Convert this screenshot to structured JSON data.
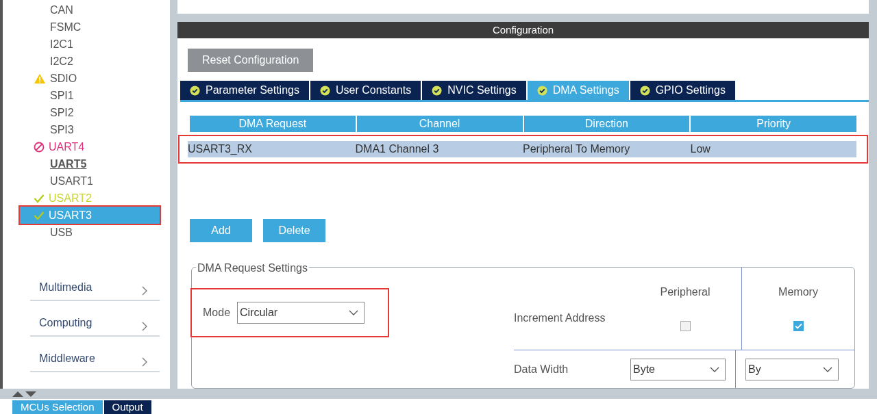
{
  "sidebar": {
    "items": [
      {
        "label": "CAN",
        "kind": "plain",
        "emphasized": false,
        "selected": false,
        "highlighted": false
      },
      {
        "label": "FSMC",
        "kind": "plain",
        "emphasized": false,
        "selected": false,
        "highlighted": false
      },
      {
        "label": "I2C1",
        "kind": "plain",
        "emphasized": false,
        "selected": false,
        "highlighted": false
      },
      {
        "label": "I2C2",
        "kind": "plain",
        "emphasized": false,
        "selected": false,
        "highlighted": false
      },
      {
        "label": "SDIO",
        "kind": "warning",
        "emphasized": false,
        "selected": false,
        "highlighted": false
      },
      {
        "label": "SPI1",
        "kind": "plain",
        "emphasized": false,
        "selected": false,
        "highlighted": false
      },
      {
        "label": "SPI2",
        "kind": "plain",
        "emphasized": false,
        "selected": false,
        "highlighted": false
      },
      {
        "label": "SPI3",
        "kind": "plain",
        "emphasized": false,
        "selected": false,
        "highlighted": false
      },
      {
        "label": "UART4",
        "kind": "error",
        "emphasized": false,
        "selected": false,
        "highlighted": false
      },
      {
        "label": "UART5",
        "kind": "plain",
        "emphasized": true,
        "selected": false,
        "highlighted": false
      },
      {
        "label": "USART1",
        "kind": "plain",
        "emphasized": false,
        "selected": false,
        "highlighted": false
      },
      {
        "label": "USART2",
        "kind": "ok",
        "emphasized": false,
        "selected": false,
        "highlighted": false
      },
      {
        "label": "USART3",
        "kind": "ok",
        "emphasized": false,
        "selected": true,
        "highlighted": true
      },
      {
        "label": "USB",
        "kind": "plain",
        "emphasized": false,
        "selected": false,
        "highlighted": false
      }
    ],
    "categories": [
      "Multimedia",
      "Computing",
      "Middleware"
    ]
  },
  "configuration": {
    "title": "Configuration",
    "reset_button": "Reset Configuration",
    "tabs": [
      {
        "label": "Parameter Settings",
        "selected": false
      },
      {
        "label": "User Constants",
        "selected": false
      },
      {
        "label": "NVIC Settings",
        "selected": false
      },
      {
        "label": "DMA Settings",
        "selected": true
      },
      {
        "label": "GPIO Settings",
        "selected": false
      }
    ],
    "table": {
      "columns": [
        "DMA Request",
        "Channel",
        "Direction",
        "Priority"
      ],
      "rows": [
        {
          "cells": [
            "USART3_RX",
            "DMA1 Channel 3",
            "Peripheral To Memory",
            "Low"
          ],
          "highlighted": true
        }
      ]
    },
    "buttons": [
      "Add",
      "Delete"
    ],
    "settings": {
      "title": "DMA Request Settings",
      "mode_label": "Mode",
      "mode_value": "Circular",
      "mode_highlighted": true,
      "column_headers": [
        "Peripheral",
        "Memory"
      ],
      "increment_label": "Increment Address",
      "increment": [
        {
          "checked": false
        },
        {
          "checked": true
        }
      ],
      "width_label": "Data Width",
      "widths": [
        "Byte",
        "By"
      ]
    }
  },
  "bottom_tabs": [
    {
      "label": "MCUs Selection",
      "selected": true
    },
    {
      "label": "Output",
      "selected": false
    }
  ]
}
